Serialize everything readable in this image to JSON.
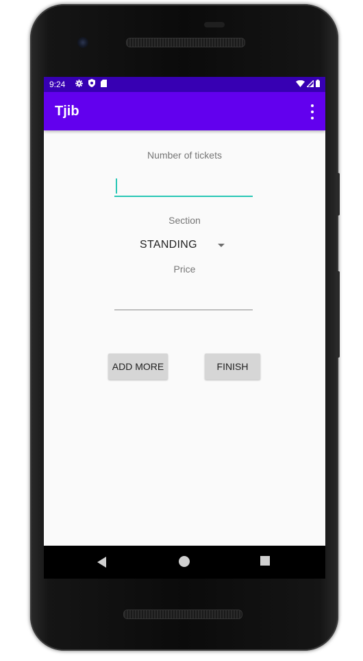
{
  "status_bar": {
    "time": "9:24",
    "left_icons": [
      "settings-icon",
      "shield-icon",
      "sd-card-icon"
    ],
    "right_icons": [
      "wifi-icon",
      "signal-icon",
      "battery-icon"
    ],
    "color": "#3700b3"
  },
  "app_bar": {
    "title": "Tjib",
    "menu_icon": "overflow-menu-icon",
    "color": "#6200ee"
  },
  "form": {
    "tickets_label": "Number of tickets",
    "tickets_value": "",
    "section_label": "Section",
    "section_selected": "STANDING",
    "price_label": "Price",
    "price_value": ""
  },
  "buttons": {
    "add_more": "ADD MORE",
    "finish": "FINISH"
  },
  "nav_bar": {
    "icons": [
      "back-icon",
      "home-icon",
      "recents-icon"
    ]
  },
  "colors": {
    "accent": "#26c6b4",
    "background": "#fafafa"
  }
}
